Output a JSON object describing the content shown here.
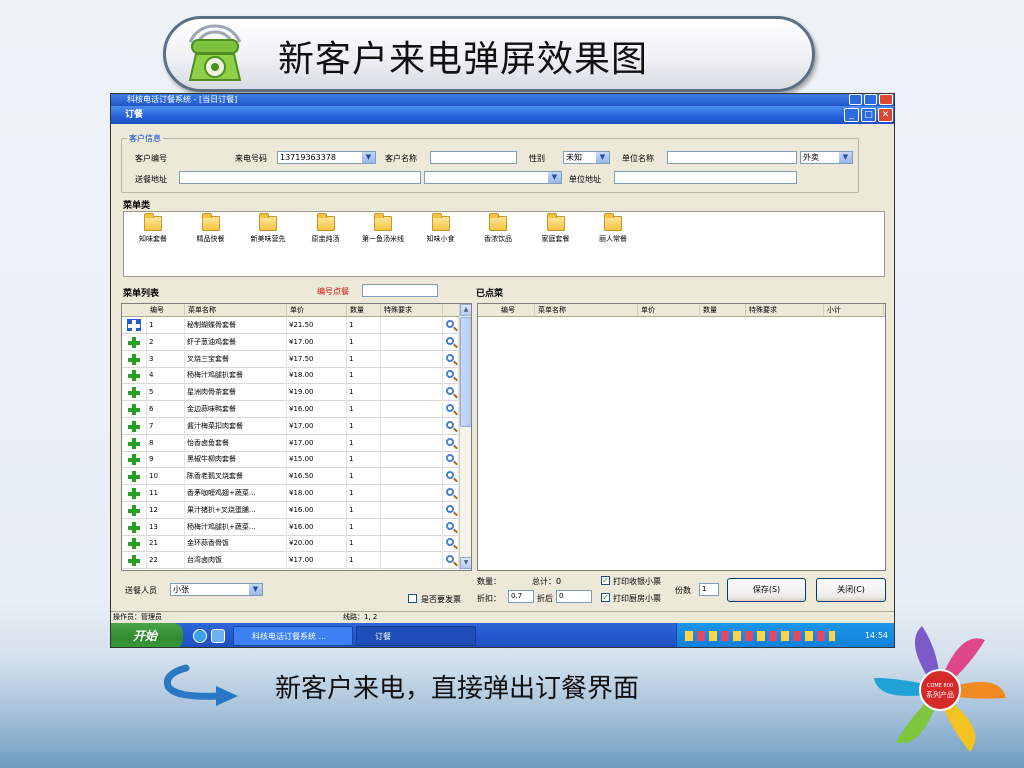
{
  "slide_title": "新客户来电弹屏效果图",
  "caption": "新客户来电，直接弹出订餐界面",
  "icons": {
    "phone": "telephone-icon",
    "arrow": "curved-arrow-icon",
    "logo": "come800-flower-logo"
  },
  "logo": {
    "center_line1": "COME 800",
    "center_line2": "系列产品"
  },
  "outer_window_title": "科核电话订餐系统 - [当日订餐]",
  "window": {
    "icon": "app-icon",
    "title": "订餐",
    "min": "_",
    "max": "□",
    "close": "✕"
  },
  "customer": {
    "group_title": "客户信息",
    "code_label": "客户编号",
    "code_value": "",
    "phone_label": "来电号码",
    "phone_value": "13719363378",
    "name_label": "客户名称",
    "name_value": "",
    "gender_label": "性别",
    "gender_value": "未知",
    "unit_label": "单位名称",
    "unit_value": "",
    "order_type": "外卖",
    "address_label": "送餐地址",
    "address_value": "",
    "address_combo": "",
    "unit_address_label": "单位地址",
    "unit_address_value": ""
  },
  "categories": {
    "title": "菜单类",
    "items": [
      "知味套餐",
      "精品快餐",
      "新美味营先",
      "原盅炖汤",
      "第一鱼汤米线",
      "知味小食",
      "香浓饮品",
      "家庭套餐",
      "丽人常餐"
    ]
  },
  "menu_list": {
    "title": "菜单列表",
    "code_order_label": "编号点餐",
    "code_order_value": "",
    "columns": [
      "编号",
      "菜单名称",
      "单价",
      "数量",
      "特殊要求"
    ],
    "rows": [
      {
        "no": "1",
        "name": "秘制蝴蝶骨套餐",
        "price": "¥21.50",
        "qty": "1"
      },
      {
        "no": "2",
        "name": "虾子葱油鸡套餐",
        "price": "¥17.00",
        "qty": "1"
      },
      {
        "no": "3",
        "name": "叉烧三宝套餐",
        "price": "¥17.50",
        "qty": "1"
      },
      {
        "no": "4",
        "name": "杨梅汁鸡腿扒套餐",
        "price": "¥18.00",
        "qty": "1"
      },
      {
        "no": "5",
        "name": "星洲肉骨茶套餐",
        "price": "¥19.00",
        "qty": "1"
      },
      {
        "no": "6",
        "name": "金边蒜味鸭套餐",
        "price": "¥16.00",
        "qty": "1"
      },
      {
        "no": "7",
        "name": "酱汁梅菜扣肉套餐",
        "price": "¥17.00",
        "qty": "1"
      },
      {
        "no": "8",
        "name": "怡香卤鱼套餐",
        "price": "¥17.00",
        "qty": "1"
      },
      {
        "no": "9",
        "name": "黑椒牛柳肉套餐",
        "price": "¥15.00",
        "qty": "1"
      },
      {
        "no": "10",
        "name": "陈香老鹅叉烧套餐",
        "price": "¥16.50",
        "qty": "1"
      },
      {
        "no": "11",
        "name": "香茅咖喱鸡翅+蔬菜...",
        "price": "¥18.00",
        "qty": "1"
      },
      {
        "no": "12",
        "name": "果汁猪扒+叉烧蛋脯...",
        "price": "¥16.00",
        "qty": "1"
      },
      {
        "no": "13",
        "name": "杨梅汁鸡腿扒+蔬菜...",
        "price": "¥16.00",
        "qty": "1"
      },
      {
        "no": "21",
        "name": "金环蒜香骨饭",
        "price": "¥20.00",
        "qty": "1"
      },
      {
        "no": "22",
        "name": "台湾卤肉饭",
        "price": "¥17.00",
        "qty": "1"
      }
    ]
  },
  "ordered": {
    "title": "已点菜",
    "columns": [
      "编号",
      "菜单名称",
      "单价",
      "数量",
      "特殊要求",
      "小计"
    ]
  },
  "bottom": {
    "delivery_label": "送餐人员",
    "delivery_value": "小张",
    "invoice_label": "是否要发票",
    "qty_label": "数量：",
    "total_label": "总计：0",
    "discount_label": "折扣：",
    "discount_value": "0.7",
    "after_label": "折后",
    "after_value": "0",
    "print_receipt_label": "打印收银小票",
    "print_kitchen_label": "打印厨房小票",
    "copies_label": "份数",
    "copies_value": "1",
    "save_label": "保存(S)",
    "close_label": "关闭(C)"
  },
  "status": {
    "operator": "操作员：管理员",
    "line": "线路：1, 2"
  },
  "taskbar": {
    "start": "开始",
    "task1": "科核电话订餐系统 ...",
    "task2": "订餐",
    "clock": "14:54"
  }
}
